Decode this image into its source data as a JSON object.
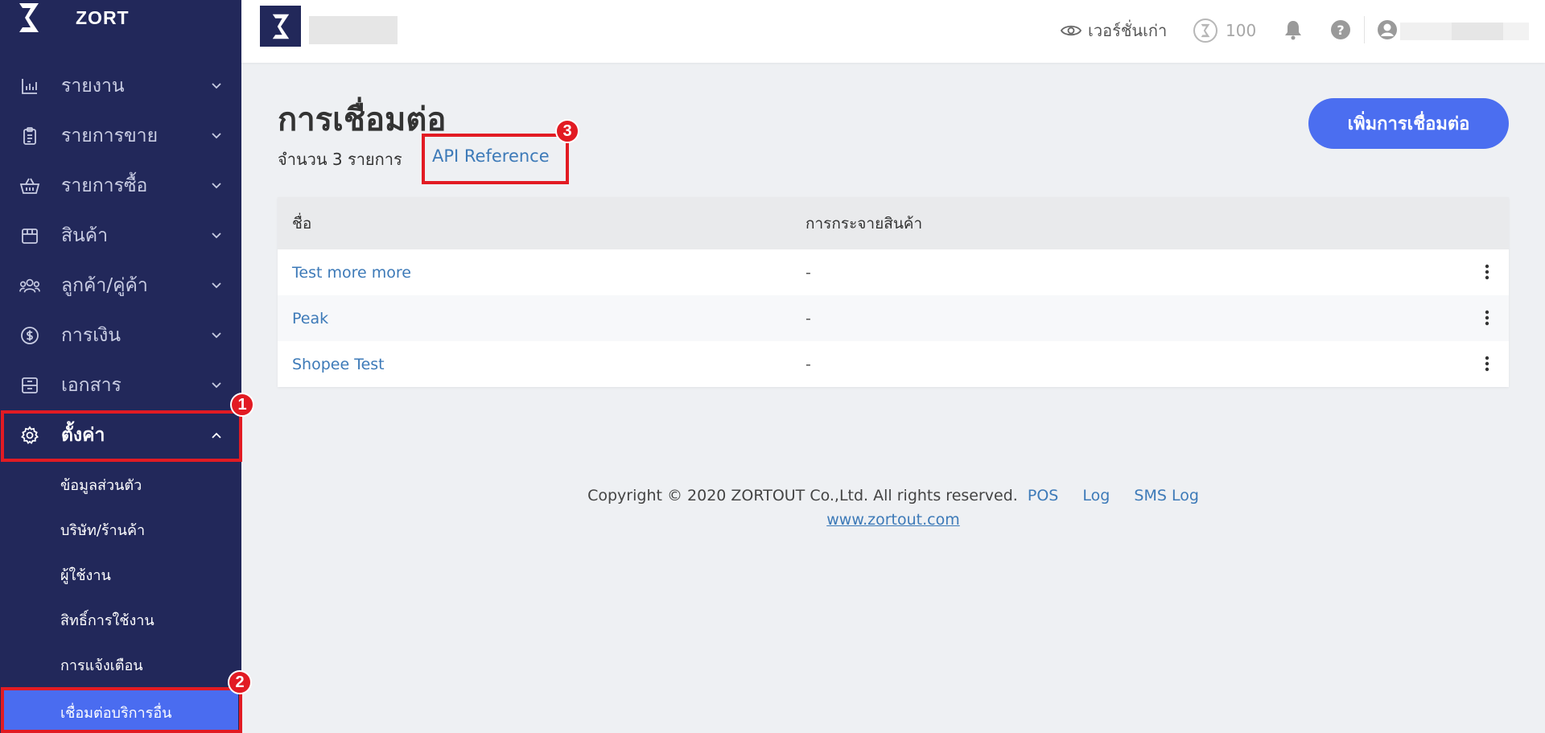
{
  "brand": {
    "name": "ZORT"
  },
  "sidebar": {
    "items": [
      {
        "label": "รายงาน",
        "icon": "bar-chart-icon"
      },
      {
        "label": "รายการขาย",
        "icon": "clipboard-icon"
      },
      {
        "label": "รายการซื้อ",
        "icon": "basket-icon"
      },
      {
        "label": "สินค้า",
        "icon": "box-icon"
      },
      {
        "label": "ลูกค้า/คู่ค้า",
        "icon": "users-icon"
      },
      {
        "label": "การเงิน",
        "icon": "dollar-icon"
      },
      {
        "label": "เอกสาร",
        "icon": "archive-icon"
      },
      {
        "label": "ตั้งค่า",
        "icon": "gear-icon"
      }
    ],
    "settings_sub": [
      {
        "label": "ข้อมูลส่วนตัว"
      },
      {
        "label": "บริษัท/ร้านค้า"
      },
      {
        "label": "ผู้ใช้งาน"
      },
      {
        "label": "สิทธิ์การใช้งาน"
      },
      {
        "label": "การแจ้งเตือน"
      },
      {
        "label": "เชื่อมต่อบริการอื่น"
      }
    ]
  },
  "annotations": {
    "badge_1": "1",
    "badge_2": "2",
    "badge_3": "3",
    "color": "#e21b23"
  },
  "topbar": {
    "old_version_label": "เวอร์ชั่นเก่า",
    "points": "100"
  },
  "main": {
    "title": "การเชื่อมต่อ",
    "count_text": "จำนวน 3 รายการ",
    "api_reference_label": "API Reference",
    "add_button_label": "เพิ่มการเชื่อมต่อ",
    "table": {
      "headers": [
        "ชื่อ",
        "การกระจายสินค้า"
      ],
      "rows": [
        {
          "name": "Test more more",
          "distribution": "-"
        },
        {
          "name": "Peak",
          "distribution": "-"
        },
        {
          "name": "Shopee Test",
          "distribution": "-"
        }
      ]
    }
  },
  "footer": {
    "copyright": "Copyright © 2020 ZORTOUT Co.,Ltd. All rights reserved.",
    "links": [
      "POS",
      "Log",
      "SMS Log"
    ],
    "website": "www.zortout.com"
  },
  "colors": {
    "sidebar_bg": "#22285a",
    "accent": "#4b6ef0",
    "link": "#3d7ab8"
  }
}
